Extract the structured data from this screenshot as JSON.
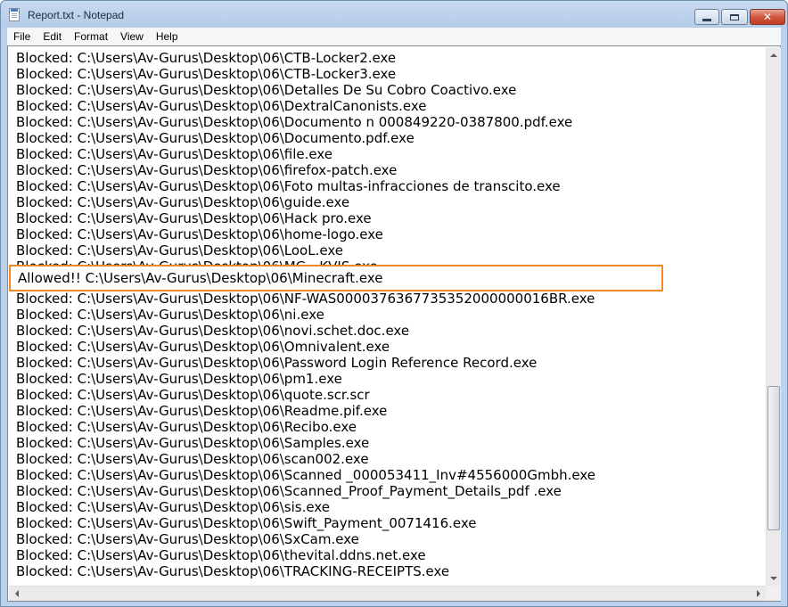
{
  "window": {
    "title": "Report.txt - Notepad"
  },
  "menu": [
    "File",
    "Edit",
    "Format",
    "View",
    "Help"
  ],
  "lines_before": [
    "Blocked: C:\\Users\\Av-Gurus\\Desktop\\06\\CTB-Locker2.exe",
    "Blocked: C:\\Users\\Av-Gurus\\Desktop\\06\\CTB-Locker3.exe",
    "Blocked: C:\\Users\\Av-Gurus\\Desktop\\06\\Detalles De Su Cobro Coactivo.exe",
    "Blocked: C:\\Users\\Av-Gurus\\Desktop\\06\\DextralCanonists.exe",
    "Blocked: C:\\Users\\Av-Gurus\\Desktop\\06\\Documento n 000849220-0387800.pdf.exe",
    "Blocked: C:\\Users\\Av-Gurus\\Desktop\\06\\Documento.pdf.exe",
    "Blocked: C:\\Users\\Av-Gurus\\Desktop\\06\\file.exe",
    "Blocked: C:\\Users\\Av-Gurus\\Desktop\\06\\firefox-patch.exe",
    "Blocked: C:\\Users\\Av-Gurus\\Desktop\\06\\Foto multas-infracciones de transcito.exe",
    "Blocked: C:\\Users\\Av-Gurus\\Desktop\\06\\guide.exe",
    "Blocked: C:\\Users\\Av-Gurus\\Desktop\\06\\Hack pro.exe",
    "Blocked: C:\\Users\\Av-Gurus\\Desktop\\06\\home-logo.exe",
    "Blocked: C:\\Users\\Av-Gurus\\Desktop\\06\\LooL.exe",
    "Blocked: C:\\Users\\Av-Gurus\\Desktop\\06\\MG - KVIS.exe"
  ],
  "highlighted_line": "Allowed!! C:\\Users\\Av-Gurus\\Desktop\\06\\Minecraft.exe",
  "lines_after": [
    "Blocked: C:\\Users\\Av-Gurus\\Desktop\\06\\NF-WAS0000376367735352000000016BR.exe",
    "Blocked: C:\\Users\\Av-Gurus\\Desktop\\06\\ni.exe",
    "Blocked: C:\\Users\\Av-Gurus\\Desktop\\06\\novi.schet.doc.exe",
    "Blocked: C:\\Users\\Av-Gurus\\Desktop\\06\\Omnivalent.exe",
    "Blocked: C:\\Users\\Av-Gurus\\Desktop\\06\\Password Login Reference Record.exe",
    "Blocked: C:\\Users\\Av-Gurus\\Desktop\\06\\pm1.exe",
    "Blocked: C:\\Users\\Av-Gurus\\Desktop\\06\\quote.scr.scr",
    "Blocked: C:\\Users\\Av-Gurus\\Desktop\\06\\Readme.pif.exe",
    "Blocked: C:\\Users\\Av-Gurus\\Desktop\\06\\Recibo.exe",
    "Blocked: C:\\Users\\Av-Gurus\\Desktop\\06\\Samples.exe",
    "Blocked: C:\\Users\\Av-Gurus\\Desktop\\06\\scan002.exe",
    "Blocked: C:\\Users\\Av-Gurus\\Desktop\\06\\Scanned _000053411_Inv#4556000Gmbh.exe",
    "Blocked: C:\\Users\\Av-Gurus\\Desktop\\06\\Scanned_Proof_Payment_Details_pdf .exe",
    "Blocked: C:\\Users\\Av-Gurus\\Desktop\\06\\sis.exe",
    "Blocked: C:\\Users\\Av-Gurus\\Desktop\\06\\Swift_Payment_0071416.exe",
    "Blocked: C:\\Users\\Av-Gurus\\Desktop\\06\\SxCam.exe",
    "Blocked: C:\\Users\\Av-Gurus\\Desktop\\06\\thevital.ddns.net.exe",
    "Blocked: C:\\Users\\Av-Gurus\\Desktop\\06\\TRACKING-RECEIPTS.exe"
  ],
  "colors": {
    "highlight_border": "#ef8a2a",
    "title_bar": "#c7d9ef",
    "close_button": "#c23a22"
  },
  "icons": {
    "app": "notepad-icon",
    "minimize": "minimize-icon",
    "maximize": "maximize-icon",
    "close": "close-icon"
  }
}
